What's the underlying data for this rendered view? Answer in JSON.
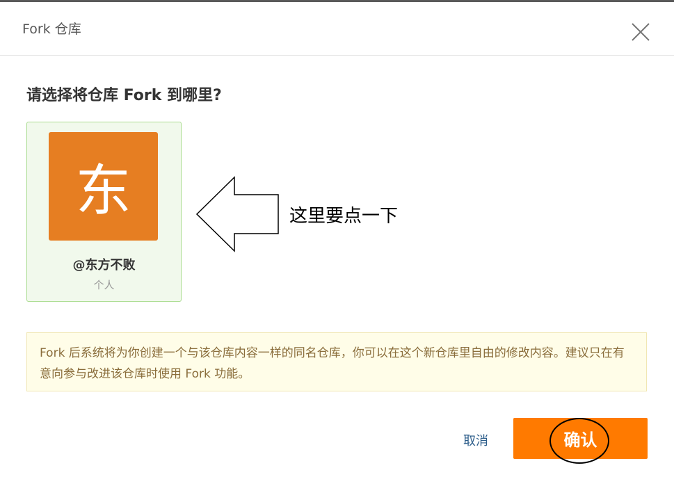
{
  "dialog": {
    "title": "Fork 仓库",
    "question": "请选择将仓库 Fork 到哪里?"
  },
  "owner": {
    "avatar_char": "东",
    "avatar_color": "#e67e22",
    "name": "@东方不败",
    "type": "个人"
  },
  "annotation": {
    "text": "这里要点一下"
  },
  "notice": {
    "text": "Fork 后系统将为你创建一个与该仓库内容一样的同名仓库，你可以在这个新仓库里自由的修改内容。建议只在有意向参与改进该仓库时使用 Fork 功能。"
  },
  "actions": {
    "cancel_label": "取消",
    "confirm_label": "确认"
  },
  "colors": {
    "accent": "#ff7a00",
    "card_bg": "#f1f9ec",
    "card_border": "#a9dc8f",
    "notice_bg": "#fffde8",
    "notice_text": "#8a6d3b"
  }
}
